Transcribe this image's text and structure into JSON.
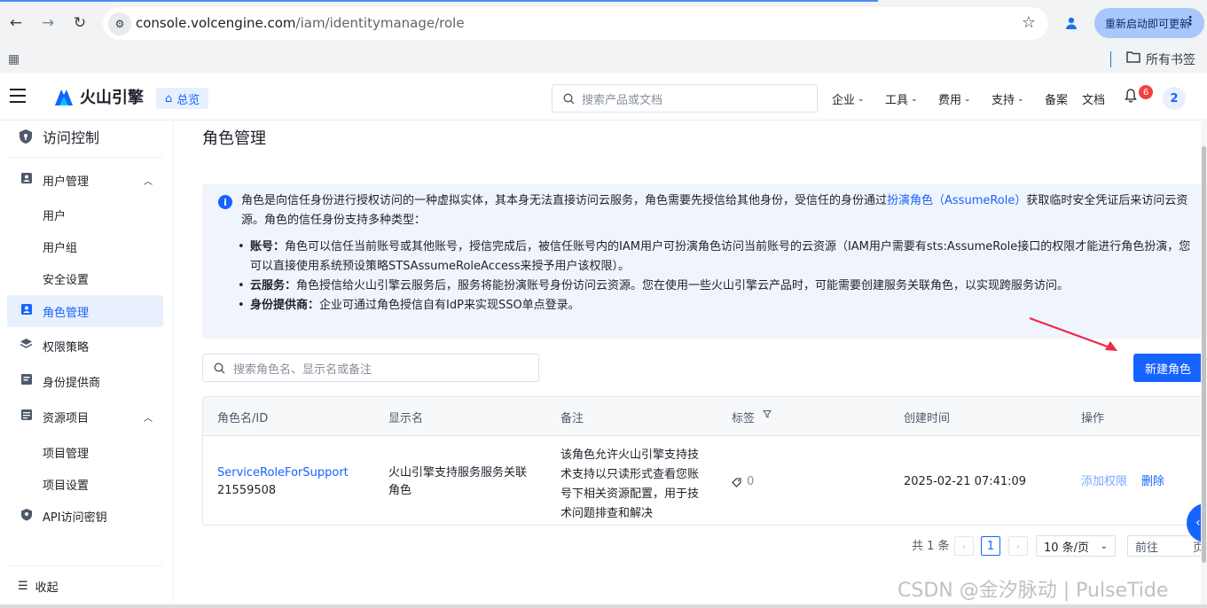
{
  "browser": {
    "url_host": "console.volcengine.com",
    "url_path": "/iam/identitymanage/role",
    "update_button": "重新启动即可更新",
    "all_bookmarks": "所有书签"
  },
  "topnav": {
    "brand": "火山引擎",
    "overview": "总览",
    "search_placeholder": "搜索产品或文档",
    "menus": [
      "企业",
      "工具",
      "费用",
      "支持",
      "备案",
      "文档"
    ],
    "notification_count": "6",
    "avatar_text": "2"
  },
  "sidebar": {
    "title": "访问控制",
    "items": [
      {
        "label": "用户管理"
      },
      {
        "label": "用户"
      },
      {
        "label": "用户组"
      },
      {
        "label": "安全设置"
      },
      {
        "label": "角色管理"
      },
      {
        "label": "权限策略"
      },
      {
        "label": "身份提供商"
      },
      {
        "label": "资源项目"
      },
      {
        "label": "项目管理"
      },
      {
        "label": "项目设置"
      },
      {
        "label": "API访问密钥"
      }
    ],
    "collapse": "收起"
  },
  "page": {
    "title": "角色管理",
    "info": {
      "text_before_link": "角色是向信任身份进行授权访问的一种虚拟实体，其本身无法直接访问云服务，角色需要先授信给其他身份，受信任的身份通过",
      "link": "扮演角色（AssumeRole）",
      "text_after_link": "获取临时安全凭证后来访问云资源。角色的信任身份支持多种类型：",
      "bullets": [
        {
          "term": "账号：",
          "text": "角色可以信任当前账号或其他账号，授信完成后，被信任账号内的IAM用户可扮演角色访问当前账号的云资源（IAM用户需要有sts:AssumeRole接口的权限才能进行角色扮演，您可以直接使用系统预设策略STSAssumeRoleAccess来授予用户该权限）。"
        },
        {
          "term": "云服务：",
          "text": "角色授信给火山引擎云服务后，服务将能扮演账号身份访问云资源。您在使用一些火山引擎云产品时，可能需要创建服务关联角色，以实现跨服务访问。"
        },
        {
          "term": "身份提供商：",
          "text": "企业可通过角色授信自有IdP来实现SSO单点登录。"
        }
      ]
    },
    "search_placeholder": "搜索角色名、显示名或备注",
    "new_role_button": "新建角色",
    "table": {
      "headers": [
        "角色名/ID",
        "显示名",
        "备注",
        "标签",
        "创建时间",
        "操作"
      ],
      "rows": [
        {
          "role_name": "ServiceRoleForSupport",
          "role_id": "21559508",
          "display_name_1": "火山引擎支持服务服务关联",
          "display_name_2": "角色",
          "note_lines": [
            "该角色允许火山引擎支持技",
            "术支持以只读形式查看您账",
            "号下相关资源配置，用于技",
            "术问题排查和解决"
          ],
          "tag_count": "0",
          "created_at": "2025-02-21 07:41:09",
          "action_add": "添加权限",
          "action_delete": "删除"
        }
      ]
    },
    "pagination": {
      "total": "共 1 条",
      "current_page": "1",
      "page_size": "10 条/页",
      "goto_label": "前往",
      "goto_suffix": "页"
    }
  },
  "watermark": "CSDN @金汐脉动 | PulseTide"
}
